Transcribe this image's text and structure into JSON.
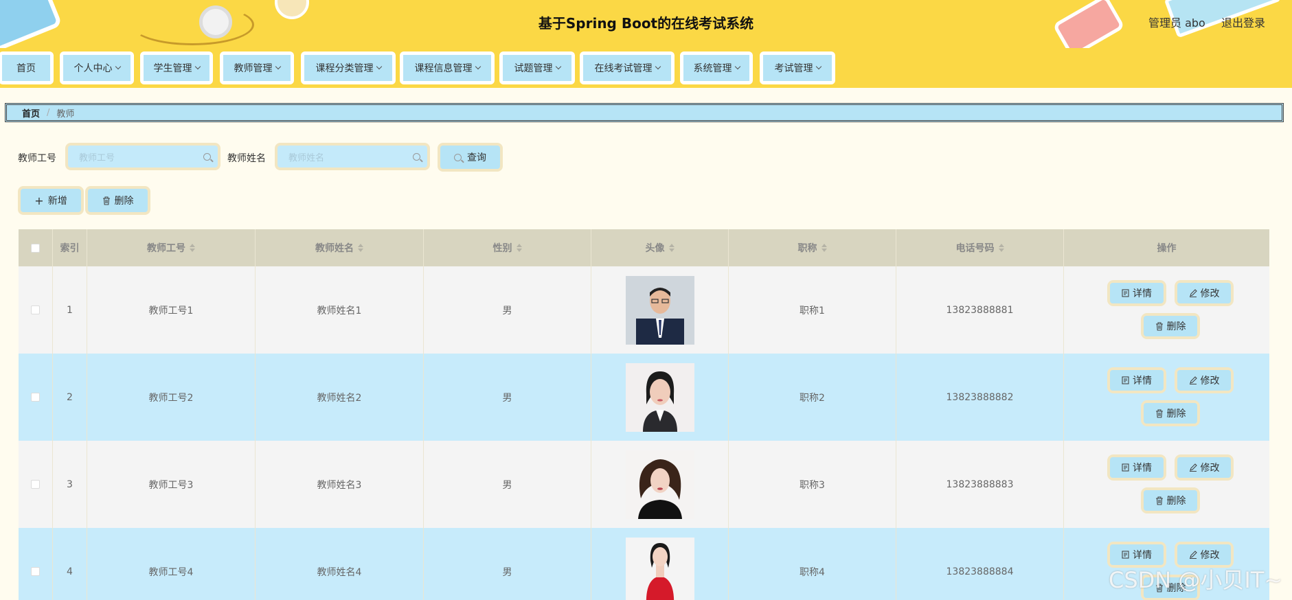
{
  "header": {
    "title": "基于Spring Boot的在线考试系统",
    "admin": "管理员 abo",
    "logout": "退出登录"
  },
  "nav": [
    {
      "label": "首页"
    },
    {
      "label": "个人中心"
    },
    {
      "label": "学生管理"
    },
    {
      "label": "教师管理"
    },
    {
      "label": "课程分类管理"
    },
    {
      "label": "课程信息管理"
    },
    {
      "label": "试题管理"
    },
    {
      "label": "在线考试管理"
    },
    {
      "label": "系统管理"
    },
    {
      "label": "考试管理"
    }
  ],
  "breadcrumb": {
    "home": "首页",
    "sep": "/",
    "current": "教师"
  },
  "search": {
    "id_label": "教师工号",
    "id_placeholder": "教师工号",
    "name_label": "教师姓名",
    "name_placeholder": "教师姓名",
    "query": "查询"
  },
  "actions": {
    "add": "新增",
    "delete": "删除"
  },
  "table": {
    "headers": [
      "索引",
      "教师工号",
      "教师姓名",
      "性别",
      "头像",
      "职称",
      "电话号码",
      "操作"
    ],
    "rows": [
      {
        "index": "1",
        "id": "教师工号1",
        "name": "教师姓名1",
        "gender": "男",
        "title": "职称1",
        "phone": "13823888881"
      },
      {
        "index": "2",
        "id": "教师工号2",
        "name": "教师姓名2",
        "gender": "男",
        "title": "职称2",
        "phone": "13823888882"
      },
      {
        "index": "3",
        "id": "教师工号3",
        "name": "教师姓名3",
        "gender": "男",
        "title": "职称3",
        "phone": "13823888883"
      },
      {
        "index": "4",
        "id": "教师工号4",
        "name": "教师姓名4",
        "gender": "男",
        "title": "职称4",
        "phone": "13823888884"
      }
    ],
    "ops": {
      "detail": "详情",
      "edit": "修改",
      "delete": "删除"
    }
  },
  "watermark": "CSDN @小贝IT~",
  "colors": {
    "header": "#fbd845",
    "accent": "#b6e4f6",
    "row_alt": "#c7ebfb",
    "thead": "#d8d5c0"
  }
}
